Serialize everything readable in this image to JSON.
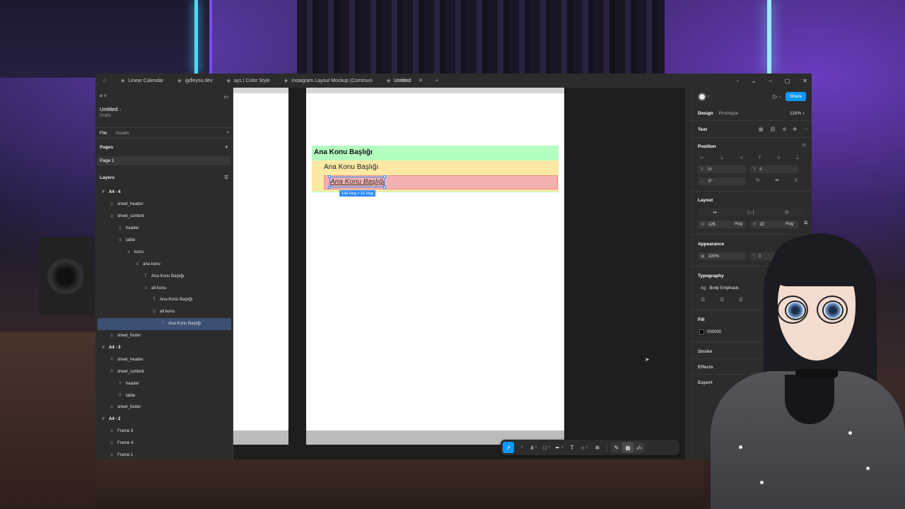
{
  "tabs": [
    {
      "label": "Linear Calendar",
      "active": false
    },
    {
      "label": "igdleysu.dev",
      "active": false
    },
    {
      "label": "ays | Color Style",
      "active": false
    },
    {
      "label": "Instagram Layout Mockup (Communi",
      "active": false
    },
    {
      "label": "Untitled",
      "active": true
    }
  ],
  "left_panel": {
    "project_title": "Untitled",
    "project_sub": "Drafts",
    "tab_file": "File",
    "tab_assets": "Assets",
    "pages_heading": "Pages",
    "page_item": "Page 1",
    "layers_heading": "Layers",
    "layers": [
      {
        "label": "A4 - 4",
        "icon": "frame-icon",
        "bold": true,
        "selected": false
      },
      {
        "label": "sheet_header",
        "icon": "grid-icon",
        "bold": false,
        "selected": false
      },
      {
        "label": "sheet_content",
        "icon": "grid-icon",
        "bold": false,
        "selected": false
      },
      {
        "label": "header",
        "icon": "grid-icon",
        "bold": false,
        "selected": false
      },
      {
        "label": "table",
        "icon": "autolayout-icon",
        "bold": false,
        "selected": false
      },
      {
        "label": "konu",
        "icon": "autolayout-icon",
        "bold": false,
        "selected": false
      },
      {
        "label": "ana konu",
        "icon": "autolayout-icon",
        "bold": false,
        "selected": false
      },
      {
        "label": "Ana Konu Başlığı",
        "icon": "text-icon",
        "bold": false,
        "selected": false
      },
      {
        "label": "alt konu",
        "icon": "autolayout-icon",
        "bold": false,
        "selected": false
      },
      {
        "label": "Ana Konu Başlığı",
        "icon": "text-icon",
        "bold": false,
        "selected": false
      },
      {
        "label": "alt konu",
        "icon": "grid-icon",
        "bold": false,
        "selected": false
      },
      {
        "label": "Ana Konu Başlığı",
        "icon": "text-icon",
        "bold": false,
        "selected": true
      },
      {
        "label": "sheet_footer",
        "icon": "grid-icon",
        "bold": false,
        "selected": false
      },
      {
        "label": "A4 - 3",
        "icon": "frame-icon",
        "bold": true,
        "selected": false
      },
      {
        "label": "sheet_header",
        "icon": "grid-icon",
        "bold": false,
        "selected": false
      },
      {
        "label": "sheet_content",
        "icon": "grid-icon",
        "bold": false,
        "selected": false
      },
      {
        "label": "header",
        "icon": "grid-icon",
        "bold": false,
        "selected": false
      },
      {
        "label": "table",
        "icon": "grid-icon",
        "bold": false,
        "selected": false
      },
      {
        "label": "sheet_footer",
        "icon": "grid-icon",
        "bold": false,
        "selected": false
      },
      {
        "label": "A4 - 2",
        "icon": "frame-icon",
        "bold": true,
        "selected": false
      },
      {
        "label": "Frame 3",
        "icon": "grid-icon",
        "bold": false,
        "selected": false
      },
      {
        "label": "Frame 4",
        "icon": "grid-icon",
        "bold": false,
        "selected": false
      },
      {
        "label": "Frame 1",
        "icon": "grid-icon",
        "bold": false,
        "selected": false
      }
    ]
  },
  "canvas": {
    "heading_main": "Ana Konu Başlığı",
    "heading_sub": "Ana Konu Başlığı",
    "heading_selected": "Ana Konu Başlığı",
    "dimension_badge": "126 Hug × 22 Hug",
    "colors": {
      "green": "#b3ffc0",
      "yellow": "#fde9a4",
      "red": "#f4b1b1",
      "selection": "#2f8cff"
    }
  },
  "right_panel": {
    "share_label": "Share",
    "tab_design": "Design",
    "tab_prototype": "Prototype",
    "zoom": "116%",
    "selection_type": "Text",
    "position_heading": "Position",
    "x_label": "X",
    "x_value": "16",
    "y_label": "Y",
    "y_value": "4",
    "rotation_value": "0°",
    "layout_heading": "Layout",
    "w_label": "W",
    "w_value": "126",
    "w_mode": "Hug",
    "h_label": "H",
    "h_value": "22",
    "h_mode": "Hug",
    "appearance_heading": "Appearance",
    "opacity_value": "100%",
    "radius_value": "0",
    "typography_heading": "Typography",
    "text_style_prefix": "Ag",
    "text_style": "Body Emphasis",
    "fill_heading": "Fill",
    "fill_value": "000000",
    "stroke_heading": "Stroke",
    "effects_heading": "Effects",
    "export_heading": "Export",
    "accent": "#0d99ff"
  }
}
